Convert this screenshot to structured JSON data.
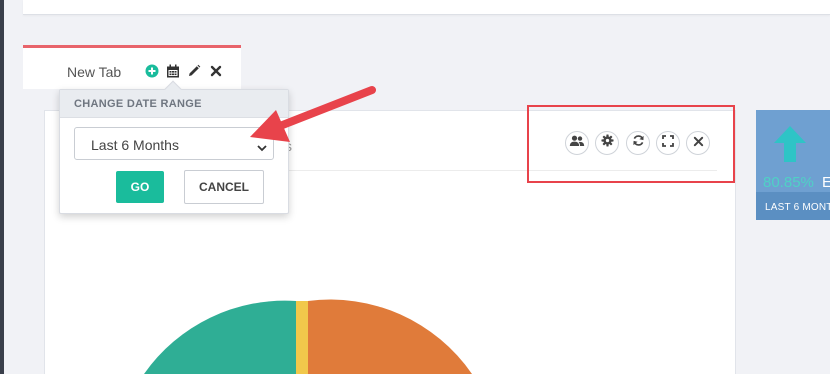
{
  "tab": {
    "label": "New Tab",
    "icons": [
      "plus-circle-icon",
      "calendar-icon",
      "pencil-icon",
      "close-icon"
    ]
  },
  "date_popover": {
    "title": "CHANGE DATE RANGE",
    "selected_range": "Last 6 Months",
    "go_label": "GO",
    "cancel_label": "CANCEL"
  },
  "widget": {
    "partial_title": "s",
    "toolbar_icons": [
      "users-icon",
      "gear-icon",
      "refresh-icon",
      "expand-icon",
      "close-icon"
    ]
  },
  "stat_card": {
    "value": "80.85%",
    "value_trailing": "E",
    "subtitle": "LAST 6 MONT"
  },
  "colors": {
    "accent_green": "#1abc9c",
    "tab_border": "#e8646b",
    "highlight_box": "#e8434b",
    "annotation_arrow": "#e8434b",
    "stat_card_blue": "#6fa0d1",
    "pie_teal": "#2fae95",
    "pie_yellow": "#f1c84b",
    "pie_orange": "#e07b3a"
  }
}
